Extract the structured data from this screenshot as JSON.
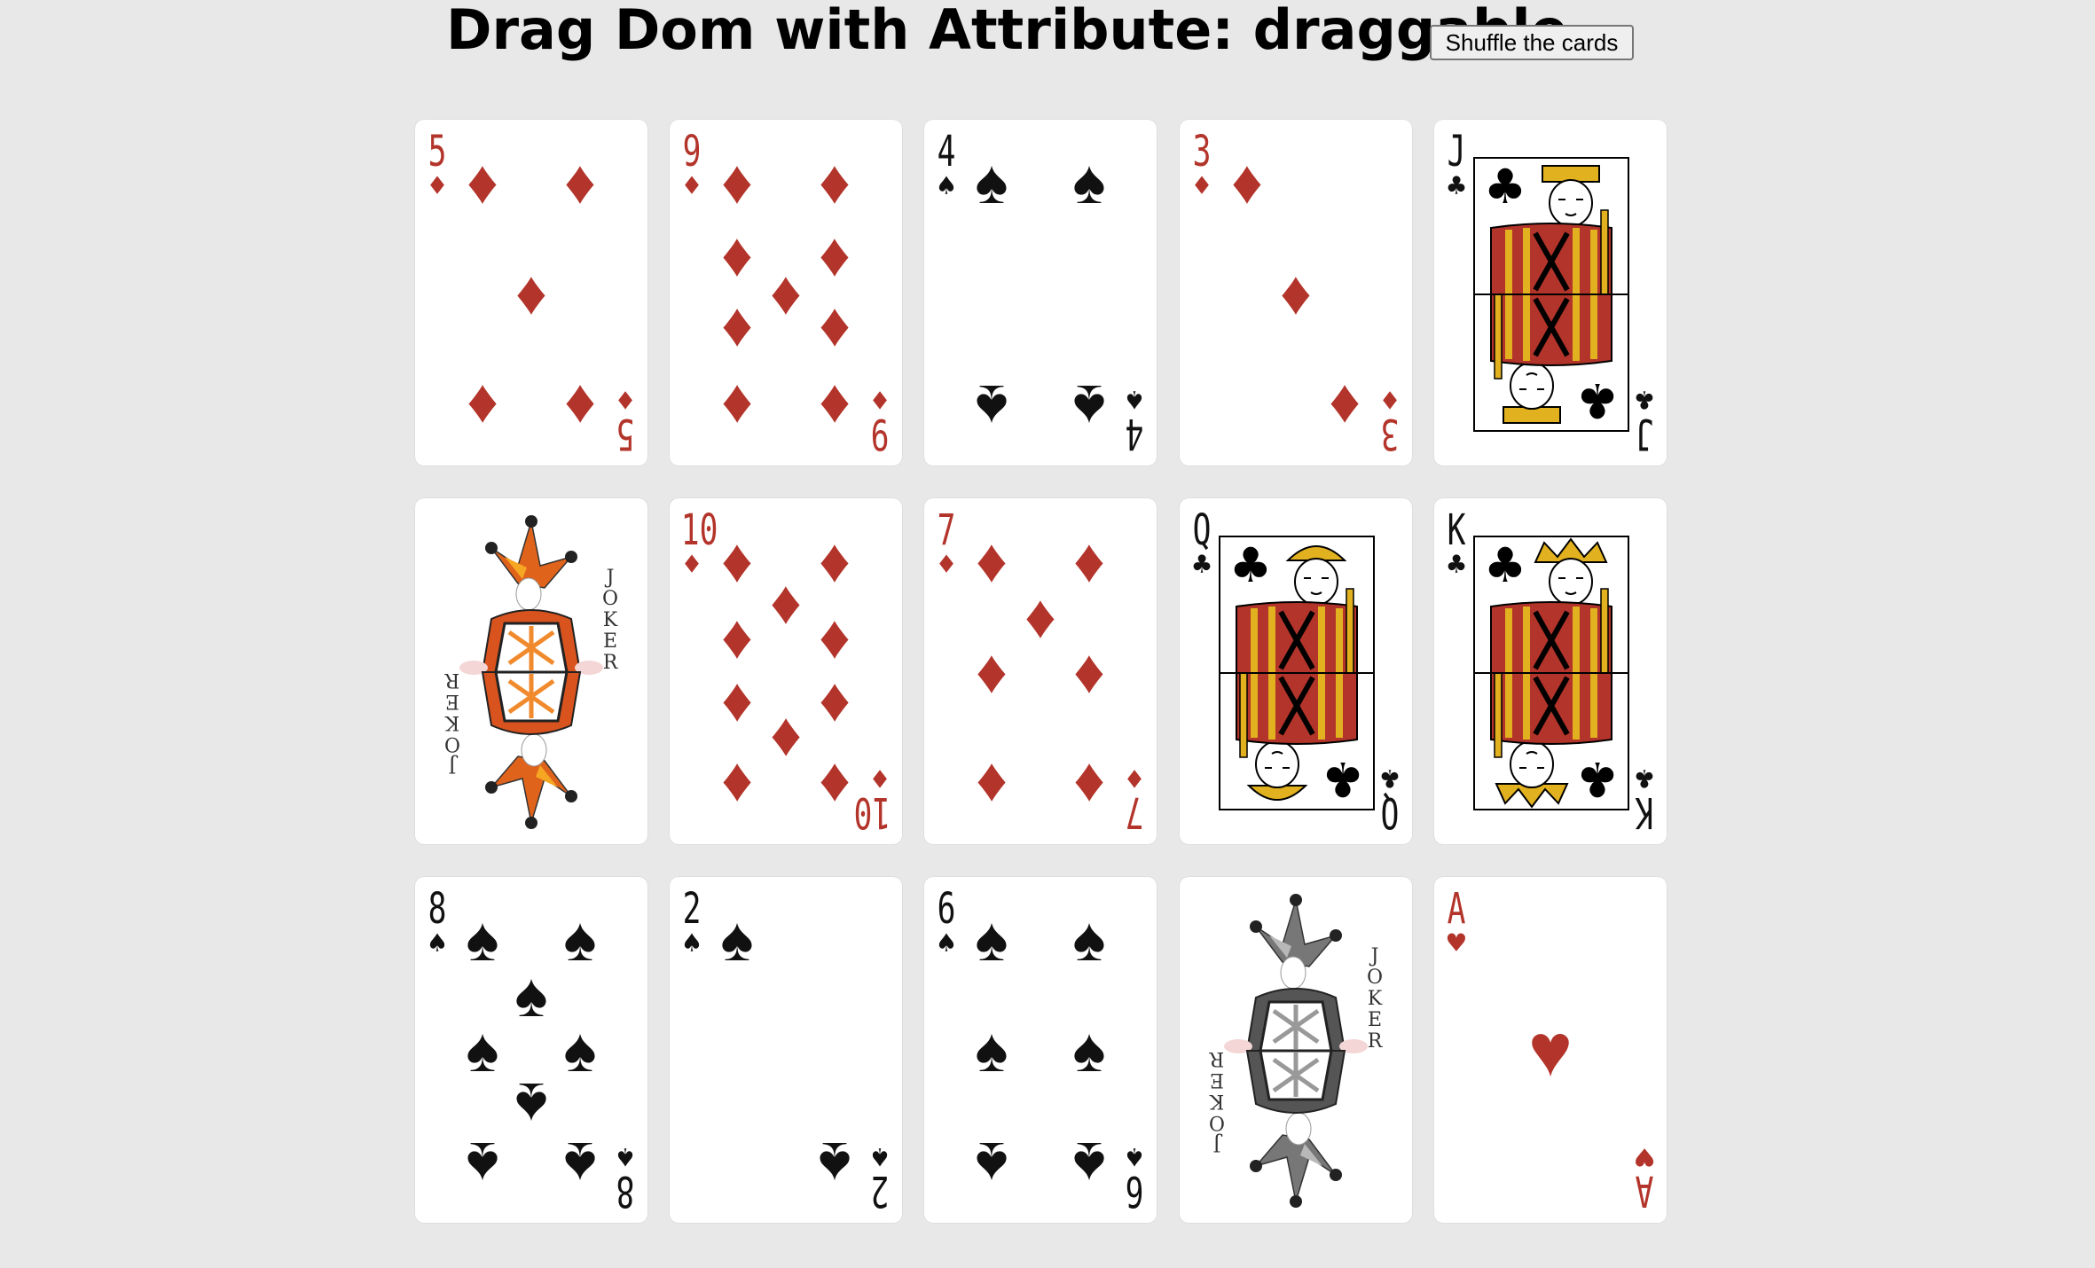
{
  "header": {
    "title": "Drag Dom with Attribute: draggable",
    "shuffle_label": "Shuffle the cards"
  },
  "cards": [
    {
      "rank": "5",
      "suit": "♦",
      "color": "red",
      "kind": "number",
      "pips": 5
    },
    {
      "rank": "9",
      "suit": "♦",
      "color": "red",
      "kind": "number",
      "pips": 9
    },
    {
      "rank": "4",
      "suit": "♠",
      "color": "black",
      "kind": "number",
      "pips": 4
    },
    {
      "rank": "3",
      "suit": "♦",
      "color": "red",
      "kind": "number",
      "pips": 3
    },
    {
      "rank": "J",
      "suit": "♣",
      "color": "black",
      "kind": "face",
      "face": "jack"
    },
    {
      "rank": "",
      "suit": "",
      "color": "red",
      "kind": "joker",
      "joker_text": "JOKER",
      "joker_style": "color"
    },
    {
      "rank": "10",
      "suit": "♦",
      "color": "red",
      "kind": "number",
      "pips": 10
    },
    {
      "rank": "7",
      "suit": "♦",
      "color": "red",
      "kind": "number",
      "pips": 7
    },
    {
      "rank": "Q",
      "suit": "♣",
      "color": "black",
      "kind": "face",
      "face": "queen"
    },
    {
      "rank": "K",
      "suit": "♣",
      "color": "black",
      "kind": "face",
      "face": "king"
    },
    {
      "rank": "8",
      "suit": "♠",
      "color": "black",
      "kind": "number",
      "pips": 8
    },
    {
      "rank": "2",
      "suit": "♠",
      "color": "black",
      "kind": "number",
      "pips": 2
    },
    {
      "rank": "6",
      "suit": "♠",
      "color": "black",
      "kind": "number",
      "pips": 6
    },
    {
      "rank": "",
      "suit": "",
      "color": "black",
      "kind": "joker",
      "joker_text": "JOKER",
      "joker_style": "gray"
    },
    {
      "rank": "A",
      "suit": "♥",
      "color": "red",
      "kind": "number",
      "pips": 1
    }
  ]
}
